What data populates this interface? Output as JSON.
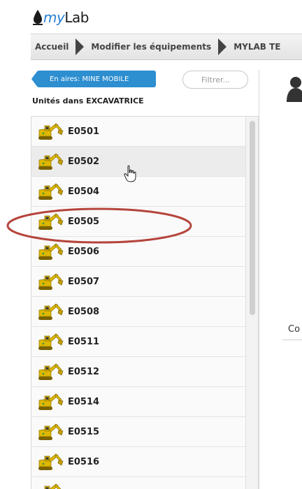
{
  "app": {
    "logo_my": "my",
    "logo_lab": "Lab"
  },
  "breadcrumb": [
    "Accueil",
    "Modifier les équipements",
    "MYLAB TE"
  ],
  "area_tag": "En aires: MINE MOBILE",
  "filter": {
    "placeholder": "Filtrer..."
  },
  "units_title": "Unités dans EXCAVATRICE",
  "units": [
    "E0501",
    "E0502",
    "E0504",
    "E0505",
    "E0506",
    "E0507",
    "E0508",
    "E0511",
    "E0512",
    "E0514",
    "E0515",
    "E0516",
    ""
  ],
  "hovered_unit": "E0502",
  "highlighted_unit": "E0505",
  "right_panel": {
    "label_fragment": "Co"
  },
  "colors": {
    "accent": "#2d8ed0",
    "annotation": "#b5443b",
    "excavator": "#e0b800"
  },
  "icons": {
    "unit": "excavator-icon",
    "avatar": "user-avatar-icon",
    "cursor": "hand-cursor-icon"
  }
}
